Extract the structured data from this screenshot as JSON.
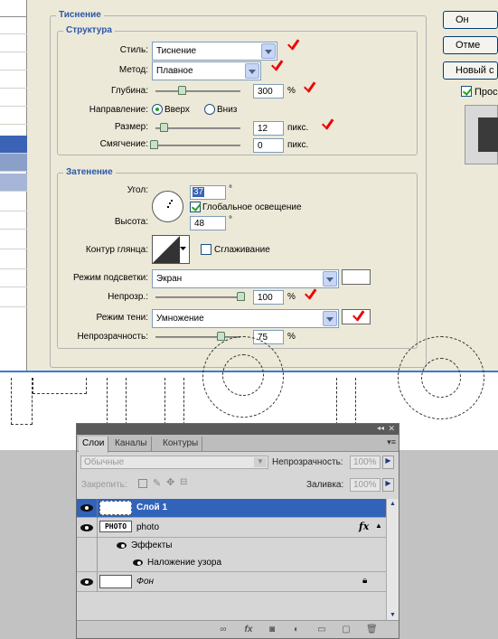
{
  "dialog": {
    "bevel_legend": "Тиснение",
    "structure": {
      "legend": "Структура",
      "style_label": "Стиль:",
      "style_value": "Тиснение",
      "method_label": "Метод:",
      "method_value": "Плавное",
      "depth_label": "Глубина:",
      "depth_value": "300",
      "depth_unit": "%",
      "direction_label": "Направление:",
      "dir_up": "Вверх",
      "dir_down": "Вниз",
      "size_label": "Размер:",
      "size_value": "12",
      "size_unit": "пикс.",
      "soften_label": "Смягчение:",
      "soften_value": "0",
      "soften_unit": "пикс."
    },
    "shading": {
      "legend": "Затенение",
      "angle_label": "Угол:",
      "angle_value": "37",
      "degree": "°",
      "global_light": "Глобальное освещение",
      "altitude_label": "Высота:",
      "altitude_value": "48",
      "gloss_label": "Контур глянца:",
      "antialias": "Сглаживание",
      "highlight_mode_label": "Режим подсветки:",
      "highlight_mode_value": "Экран",
      "highlight_opacity_label": "Непрозр.:",
      "highlight_opacity_value": "100",
      "shadow_mode_label": "Режим тени:",
      "shadow_mode_value": "Умножение",
      "shadow_opacity_label": "Непрозрачность:",
      "shadow_opacity_value": "75",
      "percent": "%"
    },
    "buttons": {
      "ok": "Он",
      "cancel": "Отме",
      "new_style": "Новый с",
      "preview": "Прос"
    }
  },
  "layers_panel": {
    "tabs": [
      "Слои",
      "Каналы",
      "Контуры"
    ],
    "blend_mode": "Обычные",
    "opacity_label": "Непрозрачность:",
    "opacity_value": "100%",
    "lock_label": "Закрепить:",
    "fill_label": "Заливка:",
    "fill_value": "100%",
    "layers": {
      "layer1": "Слой 1",
      "photo": "photo",
      "photo_thumb": "PHOTO",
      "fx": "fx",
      "effects": "Эффекты",
      "pattern_overlay": "Наложение узора",
      "background": "Фон"
    }
  },
  "colors": {
    "selection": "#3b63b5",
    "check_mark": "#e00000",
    "legend_text": "#2a57a8"
  }
}
